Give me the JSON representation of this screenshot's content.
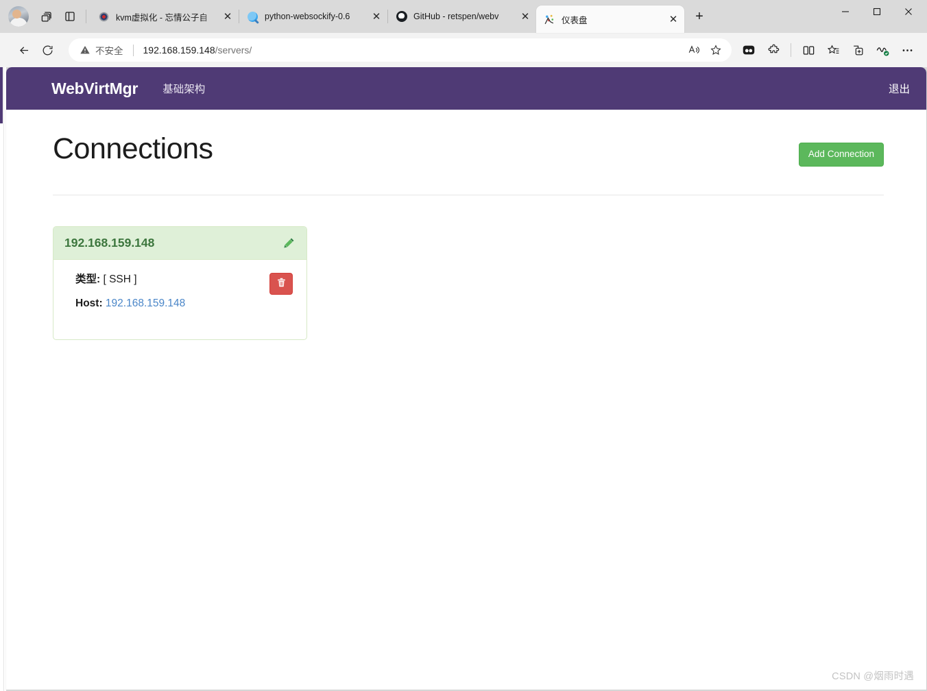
{
  "browser": {
    "profile_avatar": "user-avatar",
    "workspaces_icon": "workspaces-icon",
    "tab_actions_icon": "tab-actions-icon",
    "tabs": [
      {
        "title": "kvm虚拟化 - 忘情公子自",
        "favicon": "kvm-favicon",
        "active": false,
        "close_label": "✕"
      },
      {
        "title": "python-websockify-0.6",
        "favicon": "search-favicon",
        "active": false,
        "close_label": "✕"
      },
      {
        "title": "GitHub - retspen/webv",
        "favicon": "github-favicon",
        "active": false,
        "close_label": "✕"
      },
      {
        "title": "仪表盘",
        "favicon": "dashboard-favicon",
        "active": true,
        "close_label": "✕"
      }
    ],
    "new_tab_label": "+",
    "window_controls": {
      "minimize": "—",
      "maximize": "▢",
      "close": "✕"
    },
    "nav": {
      "back_label": "←",
      "reload_label": "⟳",
      "security_text": "不安全",
      "url_host": "192.168.159.148",
      "url_path": "/servers/",
      "read_aloud_icon": "read-aloud-icon",
      "favorite_icon": "star-icon",
      "collections_icon": "collections-icon",
      "split_screen_icon": "split-screen-icon",
      "favorites_bar_icon": "favorites-list-icon",
      "add_to_icon": "add-page-icon",
      "browser_essentials_icon": "browser-essentials-icon",
      "settings_icon": "more-options-icon",
      "extension1_icon": "copilot-icon",
      "extension2_icon": "puzzle-extension-icon"
    }
  },
  "app": {
    "brand": "WebVirtMgr",
    "nav_link": "基础架构",
    "logout": "退出",
    "page_title": "Connections",
    "add_connection_button": "Add Connection",
    "connections": [
      {
        "name": "192.168.159.148",
        "type_label": "类型:",
        "type_value": "[ SSH ]",
        "host_label": "Host:",
        "host_value": "192.168.159.148",
        "edit_icon": "pencil-icon",
        "delete_icon": "trash-icon"
      }
    ]
  },
  "watermark": "CSDN @烟雨时遇",
  "colors": {
    "navbar_purple": "#4f3a75",
    "success_green": "#5cb85c",
    "card_header_green": "#dff0d8",
    "card_title_green": "#3c763d",
    "danger_red": "#d9534f",
    "link_blue": "#4a86c8"
  }
}
